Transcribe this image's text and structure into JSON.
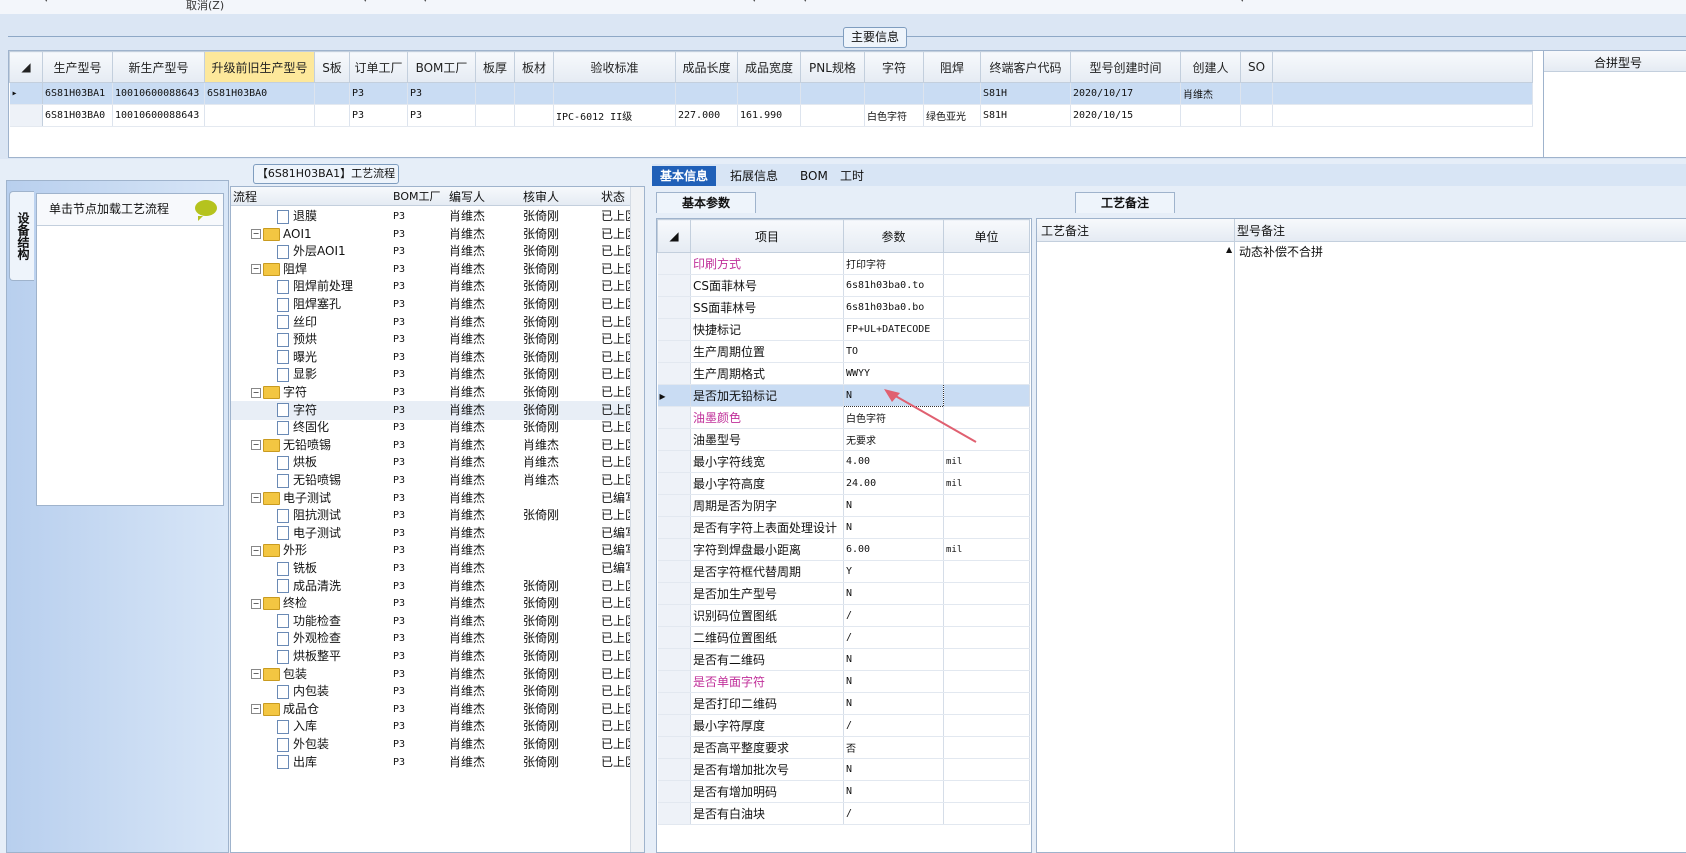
{
  "toolbar": {
    "cancel_label": "取消(Z)"
  },
  "section_title": "主要信息",
  "main_grid": {
    "columns": [
      "生产型号",
      "新生产型号",
      "升级前旧生产型号",
      "S板",
      "订单工厂",
      "BOM工厂",
      "板厚",
      "板材",
      "验收标准",
      "成品长度",
      "成品宽度",
      "PNL规格",
      "字符",
      "阻焊",
      "终端客户代码",
      "型号创建时间",
      "创建人",
      "SO"
    ],
    "rows": [
      [
        "6S81H03BA1",
        "10010600088643",
        "6S81H03BA0",
        "",
        "P3",
        "P3",
        "",
        "",
        "",
        "",
        "",
        "",
        "",
        "",
        "S81H",
        "2020/10/17",
        "肖维杰",
        ""
      ],
      [
        "6S81H03BA0",
        "10010600088643",
        "",
        "",
        "P3",
        "P3",
        "",
        "",
        "IPC-6012 II级",
        "227.000",
        "161.990",
        "",
        "白色字符",
        "绿色亚光",
        "S81H",
        "2020/10/15",
        "",
        ""
      ]
    ],
    "right_column": "合拼型号"
  },
  "left_panel": {
    "vertical_tab": "设备结构",
    "hint": "单击节点加载工艺流程"
  },
  "tree_title": "【6S81H03BA1】工艺流程",
  "tree_headers": {
    "name": "流程",
    "bom": "BOM工厂",
    "writer": "编写人",
    "reviewer": "核审人",
    "status": "状态"
  },
  "tree_rows": [
    {
      "level": 2,
      "name": "退膜",
      "bom": "P3",
      "writer": "肖维杰",
      "reviewer": "张倚刚",
      "status": "已上区"
    },
    {
      "level": 1,
      "name": "AOI1",
      "bom": "P3",
      "writer": "肖维杰",
      "reviewer": "张倚刚",
      "status": "已上区"
    },
    {
      "level": 2,
      "name": "外层AOI1",
      "bom": "P3",
      "writer": "肖维杰",
      "reviewer": "张倚刚",
      "status": "已上区"
    },
    {
      "level": 1,
      "name": "阻焊",
      "bom": "P3",
      "writer": "肖维杰",
      "reviewer": "张倚刚",
      "status": "已上区"
    },
    {
      "level": 2,
      "name": "阻焊前处理",
      "bom": "P3",
      "writer": "肖维杰",
      "reviewer": "张倚刚",
      "status": "已上区"
    },
    {
      "level": 2,
      "name": "阻焊塞孔",
      "bom": "P3",
      "writer": "肖维杰",
      "reviewer": "张倚刚",
      "status": "已上区"
    },
    {
      "level": 2,
      "name": "丝印",
      "bom": "P3",
      "writer": "肖维杰",
      "reviewer": "张倚刚",
      "status": "已上区"
    },
    {
      "level": 2,
      "name": "预烘",
      "bom": "P3",
      "writer": "肖维杰",
      "reviewer": "张倚刚",
      "status": "已上区"
    },
    {
      "level": 2,
      "name": "曝光",
      "bom": "P3",
      "writer": "肖维杰",
      "reviewer": "张倚刚",
      "status": "已上区"
    },
    {
      "level": 2,
      "name": "显影",
      "bom": "P3",
      "writer": "肖维杰",
      "reviewer": "张倚刚",
      "status": "已上区"
    },
    {
      "level": 1,
      "name": "字符",
      "bom": "P3",
      "writer": "肖维杰",
      "reviewer": "张倚刚",
      "status": "已上区"
    },
    {
      "level": 2,
      "name": "字符",
      "bom": "P3",
      "writer": "肖维杰",
      "reviewer": "张倚刚",
      "status": "已上区",
      "current": true
    },
    {
      "level": 2,
      "name": "终固化",
      "bom": "P3",
      "writer": "肖维杰",
      "reviewer": "张倚刚",
      "status": "已上区"
    },
    {
      "level": 1,
      "name": "无铅喷锡",
      "bom": "P3",
      "writer": "肖维杰",
      "reviewer": "肖维杰",
      "status": "已上区"
    },
    {
      "level": 2,
      "name": "烘板",
      "bom": "P3",
      "writer": "肖维杰",
      "reviewer": "肖维杰",
      "status": "已上区"
    },
    {
      "level": 2,
      "name": "无铅喷锡",
      "bom": "P3",
      "writer": "肖维杰",
      "reviewer": "肖维杰",
      "status": "已上区"
    },
    {
      "level": 1,
      "name": "电子测试",
      "bom": "P3",
      "writer": "肖维杰",
      "reviewer": "",
      "status": "已编写"
    },
    {
      "level": 2,
      "name": "阻抗测试",
      "bom": "P3",
      "writer": "肖维杰",
      "reviewer": "张倚刚",
      "status": "已上区"
    },
    {
      "level": 2,
      "name": "电子测试",
      "bom": "P3",
      "writer": "肖维杰",
      "reviewer": "",
      "status": "已编写"
    },
    {
      "level": 1,
      "name": "外形",
      "bom": "P3",
      "writer": "肖维杰",
      "reviewer": "",
      "status": "已编写"
    },
    {
      "level": 2,
      "name": "铣板",
      "bom": "P3",
      "writer": "肖维杰",
      "reviewer": "",
      "status": "已编写"
    },
    {
      "level": 2,
      "name": "成品清洗",
      "bom": "P3",
      "writer": "肖维杰",
      "reviewer": "张倚刚",
      "status": "已上区"
    },
    {
      "level": 1,
      "name": "终检",
      "bom": "P3",
      "writer": "肖维杰",
      "reviewer": "张倚刚",
      "status": "已上区"
    },
    {
      "level": 2,
      "name": "功能检查",
      "bom": "P3",
      "writer": "肖维杰",
      "reviewer": "张倚刚",
      "status": "已上区"
    },
    {
      "level": 2,
      "name": "外观检查",
      "bom": "P3",
      "writer": "肖维杰",
      "reviewer": "张倚刚",
      "status": "已上区"
    },
    {
      "level": 2,
      "name": "烘板整平",
      "bom": "P3",
      "writer": "肖维杰",
      "reviewer": "张倚刚",
      "status": "已上区"
    },
    {
      "level": 1,
      "name": "包装",
      "bom": "P3",
      "writer": "肖维杰",
      "reviewer": "张倚刚",
      "status": "已上区"
    },
    {
      "level": 2,
      "name": "内包装",
      "bom": "P3",
      "writer": "肖维杰",
      "reviewer": "张倚刚",
      "status": "已上区"
    },
    {
      "level": 1,
      "name": "成品仓",
      "bom": "P3",
      "writer": "肖维杰",
      "reviewer": "张倚刚",
      "status": "已上区"
    },
    {
      "level": 2,
      "name": "入库",
      "bom": "P3",
      "writer": "肖维杰",
      "reviewer": "张倚刚",
      "status": "已上区"
    },
    {
      "level": 2,
      "name": "外包装",
      "bom": "P3",
      "writer": "肖维杰",
      "reviewer": "张倚刚",
      "status": "已上区"
    },
    {
      "level": 2,
      "name": "出库",
      "bom": "P3",
      "writer": "肖维杰",
      "reviewer": "张倚刚",
      "status": "已上区"
    }
  ],
  "tabs": [
    "基本信息",
    "拓展信息",
    "BOM",
    "工时"
  ],
  "subtab": "基本参数",
  "param_headers": {
    "item": "项目",
    "param": "参数",
    "unit": "单位"
  },
  "params": [
    {
      "item": "印刷方式",
      "param": "打印字符",
      "unit": "",
      "pink": true
    },
    {
      "item": "CS面菲林号",
      "param": "6s81h03ba0.to",
      "unit": ""
    },
    {
      "item": "SS面菲林号",
      "param": "6s81h03ba0.bo",
      "unit": ""
    },
    {
      "item": "快捷标记",
      "param": "FP+UL+DATECODE",
      "unit": ""
    },
    {
      "item": "生产周期位置",
      "param": "TO",
      "unit": ""
    },
    {
      "item": "生产周期格式",
      "param": "WWYY",
      "unit": ""
    },
    {
      "item": "是否加无铅标记",
      "param": "N",
      "unit": "",
      "selected": true
    },
    {
      "item": "油墨颜色",
      "param": "白色字符",
      "unit": "",
      "pink": true
    },
    {
      "item": "油墨型号",
      "param": "无要求",
      "unit": ""
    },
    {
      "item": "最小字符线宽",
      "param": "4.00",
      "unit": "mil"
    },
    {
      "item": "最小字符高度",
      "param": "24.00",
      "unit": "mil"
    },
    {
      "item": "周期是否为阴字",
      "param": "N",
      "unit": ""
    },
    {
      "item": "是否有字符上表面处理设计",
      "param": "N",
      "unit": ""
    },
    {
      "item": "字符到焊盘最小距离",
      "param": "6.00",
      "unit": "mil"
    },
    {
      "item": "是否字符框代替周期",
      "param": "Y",
      "unit": ""
    },
    {
      "item": "是否加生产型号",
      "param": "N",
      "unit": ""
    },
    {
      "item": "识别码位置图纸",
      "param": "/",
      "unit": ""
    },
    {
      "item": "二维码位置图纸",
      "param": "/",
      "unit": ""
    },
    {
      "item": "是否有二维码",
      "param": "N",
      "unit": ""
    },
    {
      "item": "是否单面字符",
      "param": "N",
      "unit": "",
      "pink": true
    },
    {
      "item": "是否打印二维码",
      "param": "N",
      "unit": ""
    },
    {
      "item": "最小字符厚度",
      "param": "/",
      "unit": ""
    },
    {
      "item": "是否高平整度要求",
      "param": "否",
      "unit": ""
    },
    {
      "item": "是否有增加批次号",
      "param": "N",
      "unit": ""
    },
    {
      "item": "是否有增加明码",
      "param": "N",
      "unit": ""
    },
    {
      "item": "是否有白油块",
      "param": "/",
      "unit": ""
    }
  ],
  "remark_tab": "工艺备注",
  "remark_headers": {
    "process": "工艺备注",
    "model": "型号备注"
  },
  "remark_model_text": "动态补偿不合拼",
  "colors": {
    "accent": "#2060b8",
    "selected_row": "#c9dcf3",
    "highlight_header": "#fde89b",
    "pink_text": "#c0309a",
    "arrow": "#e06070"
  }
}
